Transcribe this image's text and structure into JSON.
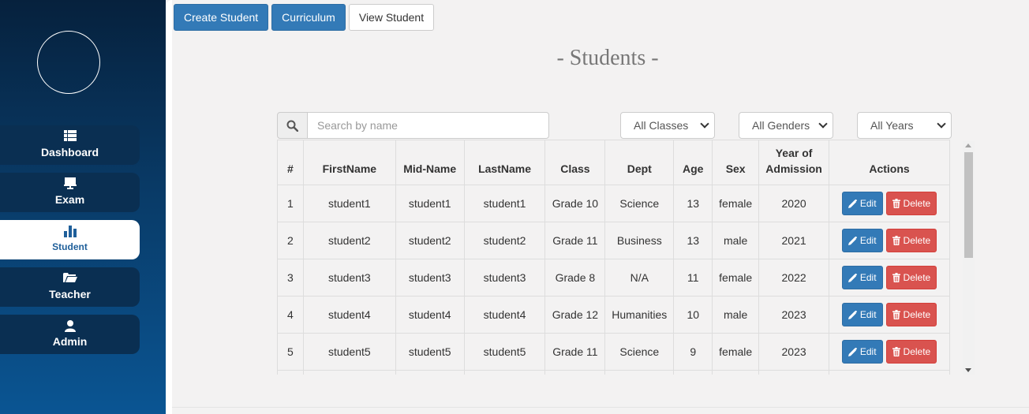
{
  "sidebar": {
    "items": [
      {
        "label": "Dashboard",
        "icon": "th-list-icon"
      },
      {
        "label": "Exam",
        "icon": "presentation-icon"
      },
      {
        "label": "Student",
        "icon": "bar-chart-icon",
        "active": true
      },
      {
        "label": "Teacher",
        "icon": "folder-open-icon"
      },
      {
        "label": "Admin",
        "icon": "user-icon"
      }
    ]
  },
  "toolbar": {
    "create_student": "Create Student",
    "curriculum": "Curriculum",
    "view_student": "View Student"
  },
  "page": {
    "title": "- Students -"
  },
  "filters": {
    "search_placeholder": "Search by name",
    "class_select": "All Classes",
    "gender_select": "All Genders",
    "year_select": "All Years"
  },
  "table": {
    "headers": [
      "#",
      "FirstName",
      "Mid-Name",
      "LastName",
      "Class",
      "Dept",
      "Age",
      "Sex",
      "Year of Admission",
      "Actions"
    ],
    "rows": [
      [
        "1",
        "student1",
        "student1",
        "student1",
        "Grade 10",
        "Science",
        "13",
        "female",
        "2020"
      ],
      [
        "2",
        "student2",
        "student2",
        "student2",
        "Grade 11",
        "Business",
        "13",
        "male",
        "2021"
      ],
      [
        "3",
        "student3",
        "student3",
        "student3",
        "Grade 8",
        "N/A",
        "11",
        "female",
        "2022"
      ],
      [
        "4",
        "student4",
        "student4",
        "student4",
        "Grade 12",
        "Humanities",
        "10",
        "male",
        "2023"
      ],
      [
        "5",
        "student5",
        "student5",
        "student5",
        "Grade 11",
        "Science",
        "9",
        "female",
        "2023"
      ]
    ],
    "edit_label": "Edit",
    "delete_label": "Delete"
  },
  "colors": {
    "primary": "#337ab7",
    "danger": "#d9534f",
    "sidebar_dark": "#06213d",
    "sidebar_item": "#0a2f52",
    "active_text": "#1f5f9a"
  }
}
